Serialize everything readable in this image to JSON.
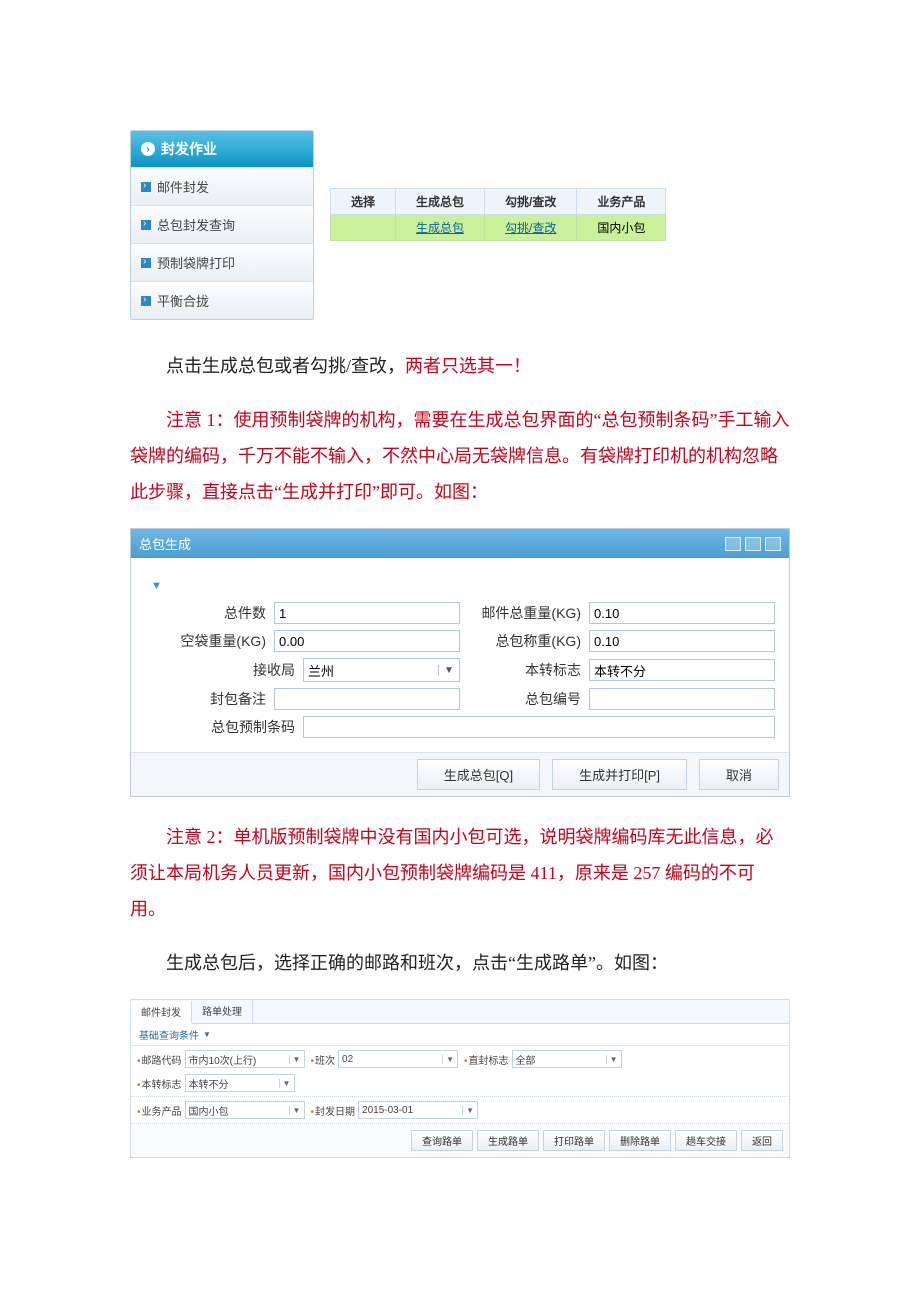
{
  "nav": {
    "header": "封发作业",
    "items": [
      "邮件封发",
      "总包封发查询",
      "预制袋牌打印",
      "平衡合拢"
    ]
  },
  "miniTable": {
    "headers": [
      "选择",
      "生成总包",
      "勾挑/查改",
      "业务产品"
    ],
    "row": {
      "link1": "生成总包",
      "link2": "勾挑/查改",
      "prod": "国内小包"
    }
  },
  "text": {
    "p1a": "点击生成总包或者勾挑/查改，",
    "p1b": "两者只选其一！",
    "p2": "注意 1：使用预制袋牌的机构，需要在生成总包界面的“总包预制条码”手工输入袋牌的编码，千万不能不输入，不然中心局无袋牌信息。有袋牌打印机的机构忽略此步骤，直接点击“生成并打印”即可。如图：",
    "p3": "注意 2：单机版预制袋牌中没有国内小包可选，说明袋牌编码库无此信息，必须让本局机务人员更新，国内小包预制袋牌编码是 411，原来是 257 编码的不可用。",
    "p4": "生成总包后，选择正确的邮路和班次，点击“生成路单”。如图："
  },
  "form": {
    "title": "总包生成",
    "labels": {
      "total_count": "总件数",
      "mail_total_weight": "邮件总重量(KG)",
      "empty_bag_weight": "空袋重量(KG)",
      "bag_weigh": "总包称重(KG)",
      "recv_bureau": "接收局",
      "transfer_flag": "本转标志",
      "seal_remark": "封包备注",
      "bag_no": "总包编号",
      "preprint_code": "总包预制条码"
    },
    "values": {
      "total_count": "1",
      "mail_total_weight": "0.10",
      "empty_bag_weight": "0.00",
      "bag_weigh": "0.10",
      "recv_bureau": "兰州",
      "transfer_flag": "本转不分",
      "seal_remark": "",
      "bag_no": "",
      "preprint_code": ""
    },
    "buttons": {
      "gen": "生成总包[Q]",
      "gen_print": "生成并打印[P]",
      "cancel": "取消"
    }
  },
  "route": {
    "tabs": [
      "邮件封发",
      "路单处理"
    ],
    "sub": "基础查询条件",
    "filters": {
      "route_code": {
        "label": "邮路代码",
        "value": "市内10次(上行)"
      },
      "batch": {
        "label": "班次",
        "value": "02"
      },
      "direct_seal": {
        "label": "直封标志",
        "value": "全部"
      },
      "transfer": {
        "label": "本转标志",
        "value": "本转不分"
      },
      "product": {
        "label": "业务产品",
        "value": "国内小包"
      },
      "seal_date": {
        "label": "封发日期",
        "value": "2015-03-01"
      }
    },
    "buttons": [
      "查询路单",
      "生成路单",
      "打印路单",
      "删除路单",
      "趟车交接",
      "返回"
    ]
  }
}
